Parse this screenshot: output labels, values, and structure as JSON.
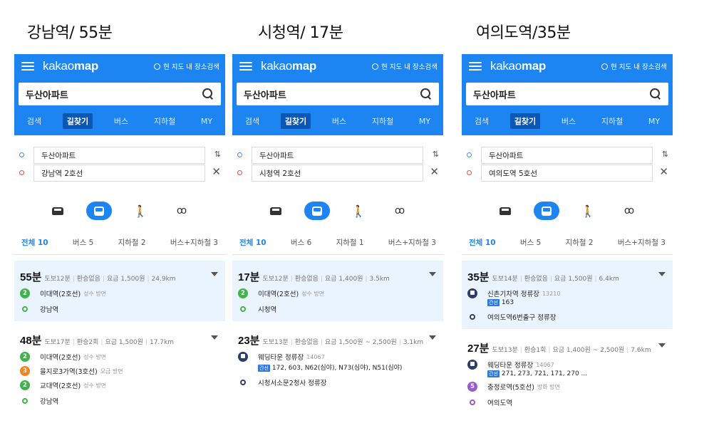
{
  "app": {
    "logo_light": "kakao",
    "logo_bold": "map",
    "here_search": "현 지도 내 장소검색",
    "query": "두산아파트",
    "tabs": [
      "검색",
      "길찾기",
      "버스",
      "지하철",
      "MY"
    ],
    "filters_label_total": "전체"
  },
  "colors": {
    "brand": "#1d85f2",
    "line2": "#3eb449",
    "line3": "#f58220",
    "line5": "#9b59d0",
    "bus": "#2a3e6b"
  },
  "panels": [
    {
      "caption": "강남역/ 55분",
      "origin": "두산아파트",
      "destination": "강남역 2호선",
      "filters": [
        "전체 10",
        "버스 5",
        "지하철 2",
        "버스+지하철 3"
      ],
      "routes": [
        {
          "minutes": "55분",
          "meta": [
            "도보12분",
            "환승없음",
            "요금 1,500원",
            "24.9km"
          ],
          "steps": [
            {
              "kind": "line",
              "badge": "2",
              "color": "#3eb449",
              "text": "이대역(2호선)",
              "dir": "성수 방면"
            },
            {
              "kind": "end",
              "color": "#3eb449",
              "text": "강남역"
            }
          ]
        },
        {
          "minutes": "48분",
          "meta": [
            "도보17분",
            "환승2회",
            "요금 1,500원",
            "17.7km"
          ],
          "steps": [
            {
              "kind": "line",
              "badge": "2",
              "color": "#3eb449",
              "text": "이대역(2호선)",
              "dir": "성수 방면"
            },
            {
              "kind": "line",
              "badge": "3",
              "color": "#f58220",
              "text": "을지로3가역(3호선)",
              "dir": "오금 방면"
            },
            {
              "kind": "line",
              "badge": "2",
              "color": "#3eb449",
              "text": "교대역(2호선)",
              "dir": "성수 방면"
            },
            {
              "kind": "end",
              "color": "#3eb449",
              "text": "강남역"
            }
          ]
        }
      ]
    },
    {
      "caption": "시청역/ 17분",
      "origin": "두산아파트",
      "destination": "시청역 2호선",
      "filters": [
        "전체 10",
        "버스 6",
        "지하철 1",
        "버스+지하철 3"
      ],
      "routes": [
        {
          "minutes": "17분",
          "meta": [
            "도보12분",
            "환승없음",
            "요금 1,400원",
            "3.5km"
          ],
          "steps": [
            {
              "kind": "line",
              "badge": "2",
              "color": "#3eb449",
              "text": "이대역(2호선)",
              "dir": "성수 방면"
            },
            {
              "kind": "end",
              "color": "#3eb449",
              "text": "시청역"
            }
          ]
        },
        {
          "minutes": "23분",
          "meta": [
            "도보13분",
            "환승없음",
            "요금 1,500원 ~ 2,500원",
            "3.1km"
          ],
          "steps": [
            {
              "kind": "bus",
              "text": "웨딩타운 정류장",
              "code": "14067",
              "tag": "간선",
              "nums": "172, 603, N62(심야), N73(심야), N51(심야)"
            },
            {
              "kind": "end",
              "color": "#2a3e6b",
              "text": "시청서소문2청사 정류장"
            }
          ]
        }
      ]
    },
    {
      "caption": "여의도역/35분",
      "origin": "두산아파트",
      "destination": "여의도역 5호선",
      "filters": [
        "전체 10",
        "버스 5",
        "지하철 2",
        "버스+지하철 3"
      ],
      "routes": [
        {
          "minutes": "35분",
          "meta": [
            "도보14분",
            "환승없음",
            "요금 1,500원",
            "6.4km"
          ],
          "steps": [
            {
              "kind": "bus",
              "text": "신촌기차역 정류장",
              "code": "13210",
              "tag": "간선",
              "nums": "163"
            },
            {
              "kind": "end",
              "color": "#2a3e6b",
              "text": "여의도역6번출구 정류장"
            }
          ]
        },
        {
          "minutes": "27분",
          "meta": [
            "도보13분",
            "환승1회",
            "요금 1,400원 ~ 2,500원",
            "7.6km"
          ],
          "steps": [
            {
              "kind": "bus",
              "text": "웨딩타운 정류장",
              "code": "14067",
              "tag": "간선",
              "nums": "271, 273, 721, 171, 270 ..."
            },
            {
              "kind": "line",
              "badge": "5",
              "color": "#9b59d0",
              "text": "충정로역(5호선)",
              "dir": "방화 방면"
            },
            {
              "kind": "end",
              "color": "#9b59d0",
              "text": "여의도역"
            }
          ]
        }
      ]
    }
  ]
}
